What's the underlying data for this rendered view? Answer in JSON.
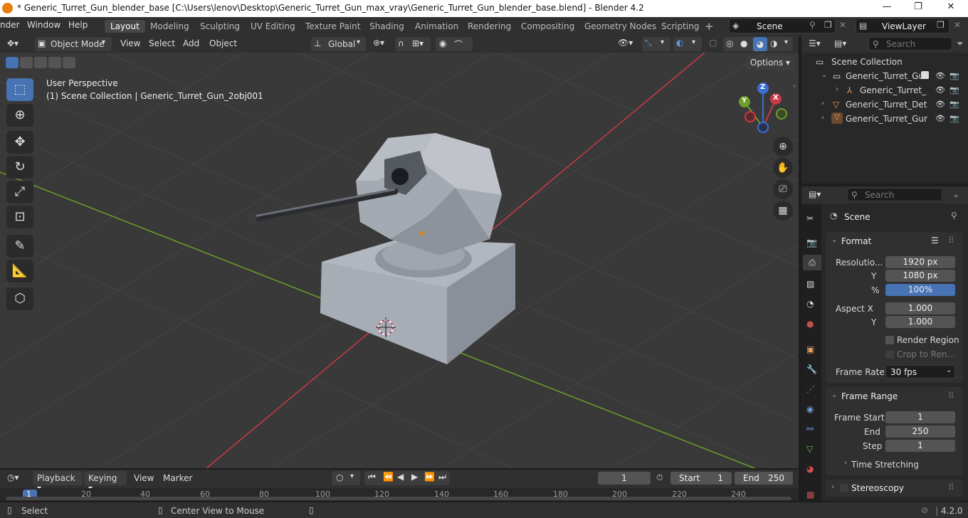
{
  "titlebar": {
    "title": "* Generic_Turret_Gun_blender_base [C:\\Users\\lenov\\Desktop\\Generic_Turret_Gun_max_vray\\Generic_Turret_Gun_blender_base.blend] - Blender 4.2",
    "minimize": "—",
    "maximize": "❐",
    "close": "✕"
  },
  "menubar": {
    "items": [
      "nder",
      "Window",
      "Help"
    ]
  },
  "workspaces": [
    "Layout",
    "Modeling",
    "Sculpting",
    "UV Editing",
    "Texture Paint",
    "Shading",
    "Animation",
    "Rendering",
    "Compositing",
    "Geometry Nodes",
    "Scripting"
  ],
  "scene": {
    "name": "Scene",
    "view_layer": "ViewLayer"
  },
  "vpheader": {
    "mode": "Object Mode",
    "menus": [
      "View",
      "Select",
      "Add",
      "Object"
    ],
    "orientation": "Global",
    "options": "Options"
  },
  "viewport": {
    "perspective": "User Perspective",
    "collection_info": "(1) Scene Collection | Generic_Turret_Gun_2obj001",
    "axes": {
      "x": "X",
      "y": "Y",
      "z": "Z"
    }
  },
  "outliner": {
    "search_placeholder": "Search",
    "root": "Scene Collection",
    "items": [
      "Generic_Turret_Gur",
      "Generic_Turret_",
      "Generic_Turret_Det",
      "Generic_Turret_Gur"
    ]
  },
  "properties": {
    "search_placeholder": "Search",
    "context": "Scene",
    "format": {
      "title": "Format",
      "resolution_label": "Resolutio...",
      "res_x": "1920 px",
      "y_label": "Y",
      "res_y": "1080 px",
      "pct_label": "%",
      "pct": "100%",
      "aspect_label": "Aspect X",
      "aspect_x": "1.000",
      "aspect_y_label": "Y",
      "aspect_y": "1.000",
      "render_region": "Render Region",
      "crop": "Crop to Ren...",
      "frame_rate_label": "Frame Rate",
      "frame_rate": "30 fps"
    },
    "frame_range": {
      "title": "Frame Range",
      "start_label": "Frame Start",
      "start": "1",
      "end_label": "End",
      "end": "250",
      "step_label": "Step",
      "step": "1"
    },
    "time_stretching": "Time Stretching",
    "stereoscopy": "Stereoscopy"
  },
  "timeline": {
    "menus": [
      "Playback",
      "Keying",
      "View",
      "Marker"
    ],
    "current_frame": "1",
    "start_label": "Start",
    "start": "1",
    "end_label": "End",
    "end": "250",
    "ruler": [
      "1",
      "20",
      "40",
      "60",
      "80",
      "100",
      "120",
      "140",
      "160",
      "180",
      "200",
      "220",
      "240"
    ]
  },
  "status": {
    "select": "Select",
    "center": "Center View to Mouse",
    "version": "4.2.0"
  },
  "colors": {
    "accent": "#4772b3",
    "x_axis": "#c83b46",
    "y_axis": "#6c9e29",
    "z_axis": "#3a6fd0"
  }
}
